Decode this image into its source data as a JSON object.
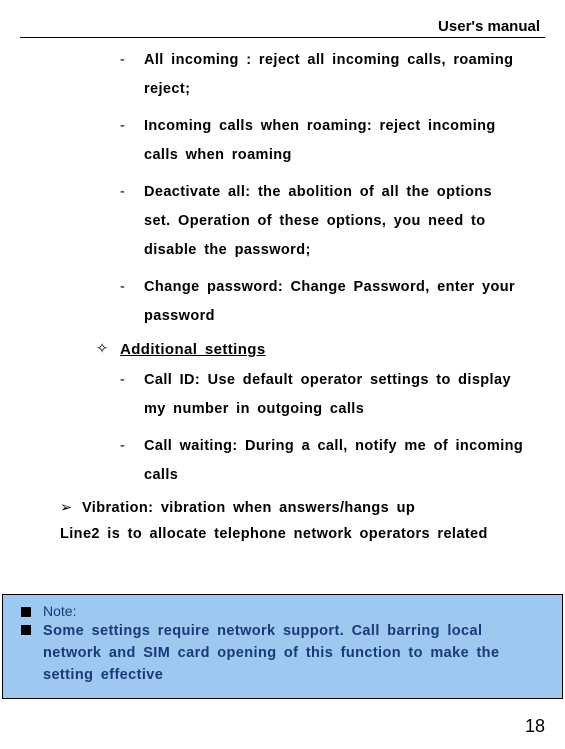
{
  "header": {
    "title": "User's manual"
  },
  "items": {
    "d1": "All incoming : reject all incoming calls, roaming reject;",
    "d2": "Incoming calls when roaming: reject incoming calls when roaming",
    "d3": "Deactivate all: the abolition of all the options set. Operation of these options, you need to disable the password;",
    "d4": "Change password: Change Password, enter your password",
    "sub_heading": "Additional settings",
    "d5": "Call ID: Use default operator settings to display my number in outgoing calls",
    "d6": "Call waiting: During a call, notify me of incoming calls",
    "vibration": "Vibration: vibration when answers/hangs up",
    "line2": "Line2 is to allocate telephone network operators related"
  },
  "note": {
    "label": "Note:",
    "text": "Some settings require network support. Call barring local network and SIM card opening of this function to make the setting effective"
  },
  "footer": {
    "page_number": "18"
  }
}
